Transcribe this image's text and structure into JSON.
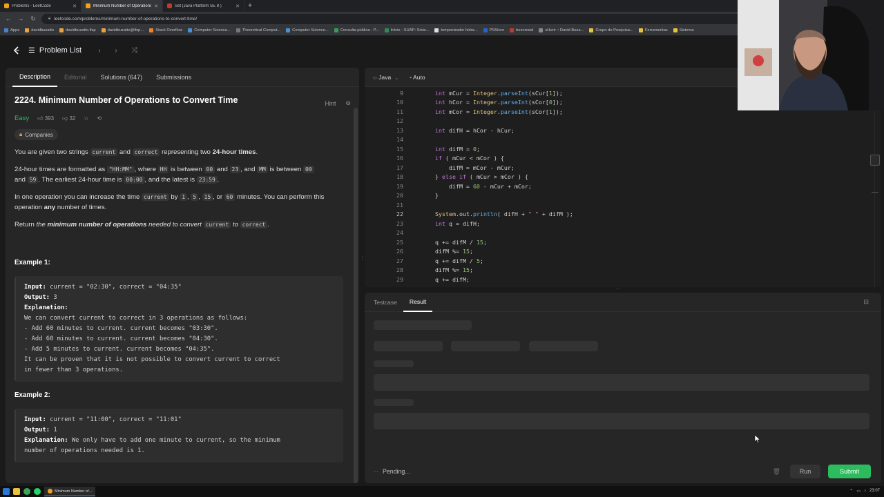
{
  "browser": {
    "tabs": [
      {
        "label": "Problems - LeetCode",
        "favicon_color": "#f0a020",
        "active": false
      },
      {
        "label": "Minimum Number of Operations",
        "favicon_color": "#f0a020",
        "active": true
      },
      {
        "label": "Set (Java Platform SE 8 )",
        "favicon_color": "#c0392b",
        "active": false
      }
    ],
    "new_tab": "+",
    "url": "leetcode.com/problems/minimum-number-of-operations-to-convert-time/",
    "bookmarks": [
      {
        "label": "Apps",
        "color": "#4a7fd1"
      },
      {
        "label": "davidbuzatto",
        "color": "#e8a33d"
      },
      {
        "label": "davidbuzatto.ifsp",
        "color": "#e8a33d"
      },
      {
        "label": "davidbuzatto@ifsp...",
        "color": "#e8a33d"
      },
      {
        "label": "Stack Overflow",
        "color": "#f48024"
      },
      {
        "label": "Computer Science...",
        "color": "#4a90d9"
      },
      {
        "label": "Theoretical Comput...",
        "color": "#777777"
      },
      {
        "label": "Computer Science...",
        "color": "#4a90d9"
      },
      {
        "label": "Consulta pública - P...",
        "color": "#3a9a5a"
      },
      {
        "label": "Início - SUAP: Siste...",
        "color": "#2e8b57"
      },
      {
        "label": "temporizador hidra...",
        "color": "#dddddd"
      },
      {
        "label": "PSStore",
        "color": "#2266cc"
      },
      {
        "label": "beecrowd",
        "color": "#c0392b"
      },
      {
        "label": "sHunt :: David Buza...",
        "color": "#888888"
      },
      {
        "label": "Grupo de Pesquisa...",
        "color": "#e8c23d"
      },
      {
        "label": "Ferramentas",
        "color": "#e8c23d"
      },
      {
        "label": "Sistema",
        "color": "#e8c23d"
      }
    ]
  },
  "lc_nav": {
    "problem_list": "Problem List",
    "prev": "‹",
    "next": "›",
    "shuffle": "⤨"
  },
  "left": {
    "tabs": [
      {
        "label": "Description",
        "state": "active"
      },
      {
        "label": "Editorial",
        "state": "dim"
      },
      {
        "label": "Solutions (647)",
        "state": "normal"
      },
      {
        "label": "Submissions",
        "state": "normal"
      }
    ],
    "title": "2224. Minimum Number of Operations to Convert Time",
    "hint": "Hint",
    "difficulty": "Easy",
    "likes": "393",
    "dislikes": "32",
    "companies": "Companies",
    "p1": {
      "a": "You are given two strings ",
      "c1": "current",
      "b": " and ",
      "c2": "correct",
      "c": " representing two ",
      "bold": "24-hour times",
      "d": "."
    },
    "p2": {
      "a": "24-hour times are formatted as ",
      "c1": "\"HH:MM\"",
      "b": ", where ",
      "c2": "HH",
      "c": " is between ",
      "c3": "00",
      "d": " and ",
      "c4": "23",
      "e": ", and ",
      "c5": "MM",
      "f": " is between ",
      "c6": "00",
      "g": " and ",
      "c7": "59",
      "h": ". The earliest 24-hour time is ",
      "c8": "00:00",
      "i": ", and the latest is ",
      "c9": "23:59",
      "j": "."
    },
    "p3": {
      "a": "In one operation you can increase the time ",
      "c1": "current",
      "b": " by ",
      "c2": "1",
      "c": ", ",
      "c3": "5",
      "d": ", ",
      "c4": "15",
      "e": ", or ",
      "c5": "60",
      "f": " minutes. You can perform this operation ",
      "bold": "any",
      "g": " number of times."
    },
    "p4": {
      "a": "Return ",
      "i1": "the ",
      "bi": "minimum number of operations",
      "i2": " needed to convert ",
      "c1": "current",
      "i3": " to ",
      "c2": "correct",
      "b": "."
    },
    "example1": {
      "heading": "Example 1:",
      "input_label": "Input:",
      "input": " current = \"02:30\", correct = \"04:35\"",
      "output_label": "Output:",
      "output": " 3",
      "explanation_label": "Explanation:",
      "lines": [
        "We can convert current to correct in 3 operations as follows:",
        "- Add 60 minutes to current. current becomes \"03:30\".",
        "- Add 60 minutes to current. current becomes \"04:30\".",
        "- Add 5 minutes to current. current becomes \"04:35\".",
        "It can be proven that it is not possible to convert current to correct",
        "in fewer than 3 operations."
      ]
    },
    "example2": {
      "heading": "Example 2:",
      "input_label": "Input:",
      "input": " current = \"11:00\", correct = \"11:01\"",
      "output_label": "Output:",
      "output": " 1",
      "explanation_label": "Explanation:",
      "explanation": " We only have to add one minute to current, so the minimum",
      "line2": "number of operations needed is 1."
    }
  },
  "editor": {
    "language": "Java",
    "mode": "Auto",
    "current_line": 22,
    "lines": [
      {
        "n": 9,
        "t": [
          [
            "    ",
            ""
          ],
          [
            "int",
            "kw"
          ],
          [
            " mCur = ",
            ""
          ],
          [
            "Integer",
            "ty"
          ],
          [
            ".",
            ""
          ],
          [
            "parseInt",
            "fn"
          ],
          [
            "(sCur[",
            ""
          ],
          [
            "1",
            "nm"
          ],
          [
            "]);",
            ""
          ]
        ]
      },
      {
        "n": 10,
        "t": [
          [
            "    ",
            ""
          ],
          [
            "int",
            "kw"
          ],
          [
            " hCor = ",
            ""
          ],
          [
            "Integer",
            "ty"
          ],
          [
            ".",
            ""
          ],
          [
            "parseInt",
            "fn"
          ],
          [
            "(sCor[",
            ""
          ],
          [
            "0",
            "nm"
          ],
          [
            "]);",
            ""
          ]
        ]
      },
      {
        "n": 11,
        "t": [
          [
            "    ",
            ""
          ],
          [
            "int",
            "kw"
          ],
          [
            " mCor = ",
            ""
          ],
          [
            "Integer",
            "ty"
          ],
          [
            ".",
            ""
          ],
          [
            "parseInt",
            "fn"
          ],
          [
            "(sCor[",
            ""
          ],
          [
            "1",
            "nm"
          ],
          [
            "]);",
            ""
          ]
        ]
      },
      {
        "n": 12,
        "t": []
      },
      {
        "n": 13,
        "t": [
          [
            "    ",
            ""
          ],
          [
            "int",
            "kw"
          ],
          [
            " difH = hCor - hCur;",
            ""
          ]
        ]
      },
      {
        "n": 14,
        "t": []
      },
      {
        "n": 15,
        "t": [
          [
            "    ",
            ""
          ],
          [
            "int",
            "kw"
          ],
          [
            " difM = ",
            ""
          ],
          [
            "0",
            "nm"
          ],
          [
            ";",
            ""
          ]
        ]
      },
      {
        "n": 16,
        "t": [
          [
            "    ",
            ""
          ],
          [
            "if",
            "kw"
          ],
          [
            " ( mCur < mCor ) {",
            ""
          ]
        ]
      },
      {
        "n": 17,
        "t": [
          [
            "        difM = mCor - mCur;",
            ""
          ]
        ]
      },
      {
        "n": 18,
        "t": [
          [
            "    } ",
            ""
          ],
          [
            "else if",
            "kw"
          ],
          [
            " ( mCur > mCor ) {",
            ""
          ]
        ]
      },
      {
        "n": 19,
        "t": [
          [
            "        difM = ",
            ""
          ],
          [
            "60",
            "nm"
          ],
          [
            " - mCur + mCor;",
            ""
          ]
        ]
      },
      {
        "n": 20,
        "t": [
          [
            "    }",
            ""
          ]
        ]
      },
      {
        "n": 21,
        "t": []
      },
      {
        "n": 22,
        "t": [
          [
            "    ",
            ""
          ],
          [
            "System",
            "ty"
          ],
          [
            ".out.",
            ""
          ],
          [
            "println",
            "fn"
          ],
          [
            "( difH + ",
            ""
          ],
          [
            "\" \"",
            "st"
          ],
          [
            " + difM );",
            ""
          ]
        ]
      },
      {
        "n": 23,
        "t": [
          [
            "    ",
            ""
          ],
          [
            "int",
            "kw"
          ],
          [
            " q = difH;",
            ""
          ]
        ]
      },
      {
        "n": 24,
        "t": []
      },
      {
        "n": 25,
        "t": [
          [
            "    q += difM / ",
            ""
          ],
          [
            "15",
            "nm"
          ],
          [
            ";",
            ""
          ]
        ]
      },
      {
        "n": 26,
        "t": [
          [
            "    difM %= ",
            ""
          ],
          [
            "15",
            "nm"
          ],
          [
            ";",
            ""
          ]
        ]
      },
      {
        "n": 27,
        "t": [
          [
            "    q += difM / ",
            ""
          ],
          [
            "5",
            "nm"
          ],
          [
            ";",
            ""
          ]
        ]
      },
      {
        "n": 28,
        "t": [
          [
            "    difM %= ",
            ""
          ],
          [
            "15",
            "nm"
          ],
          [
            ";",
            ""
          ]
        ]
      },
      {
        "n": 29,
        "t": [
          [
            "    q += difM;",
            ""
          ]
        ]
      }
    ]
  },
  "result": {
    "tabs": [
      {
        "label": "Testcase",
        "state": "normal"
      },
      {
        "label": "Result",
        "state": "active"
      }
    ],
    "status": "Pending...",
    "run": "Run",
    "submit": "Submit"
  },
  "taskbar": {
    "app_label": "Minimum Number of...",
    "time": "23:07"
  },
  "colors": {
    "accent_green": "#2cbb5d",
    "bg": "#1a1a1a",
    "panel": "#262626"
  }
}
